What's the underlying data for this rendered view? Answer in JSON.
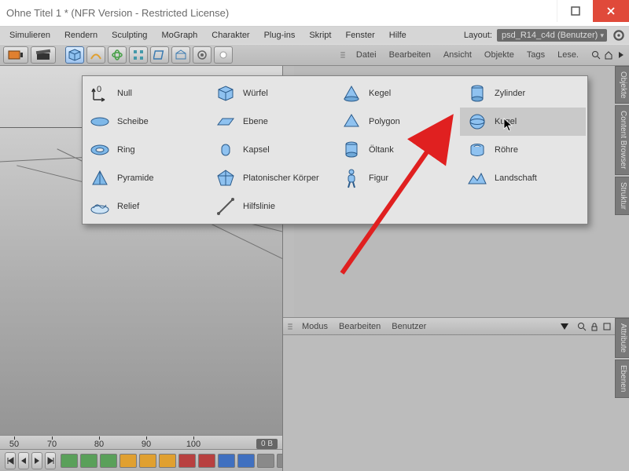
{
  "title": "Ohne Titel 1 * (NFR Version - Restricted License)",
  "menu": [
    "Simulieren",
    "Rendern",
    "Sculpting",
    "MoGraph",
    "Charakter",
    "Plug-ins",
    "Skript",
    "Fenster",
    "Hilfe"
  ],
  "layout_label": "Layout:",
  "layout_value": "psd_R14_c4d (Benutzer)",
  "obj_toolbar": [
    "Datei",
    "Bearbeiten",
    "Ansicht",
    "Objekte",
    "Tags",
    "Lese."
  ],
  "ruler": [
    "50",
    "70",
    "80",
    "90",
    "100"
  ],
  "size_label": "0 B",
  "attr_hdr": [
    "Modus",
    "Bearbeiten",
    "Benutzer"
  ],
  "side_tabs_top": [
    "Objekte",
    "Content Browser",
    "Struktur"
  ],
  "side_tabs_bottom": [
    "Attribute",
    "Ebenen"
  ],
  "primitives": {
    "col1": [
      "Null",
      "Scheibe",
      "Ring",
      "Pyramide",
      "Relief"
    ],
    "col2": [
      "Würfel",
      "Ebene",
      "Kapsel",
      "Platonischer Körper",
      "Hilfslinie"
    ],
    "col3": [
      "Kegel",
      "Polygon",
      "Öltank",
      "Figur"
    ],
    "col4": [
      "Zylinder",
      "Kugel",
      "Röhre",
      "Landschaft"
    ]
  },
  "hover_item": "Kugel",
  "icons": {
    "col1": [
      "null",
      "disc",
      "torus",
      "pyramid",
      "relief"
    ],
    "col2": [
      "cube",
      "plane",
      "capsule",
      "platonic",
      "guide"
    ],
    "col3": [
      "cone",
      "polygon",
      "oiltank",
      "figure"
    ],
    "col4": [
      "cylinder",
      "sphere",
      "tube",
      "landscape"
    ]
  },
  "chip_colors": [
    "#5aa05a",
    "#5aa05a",
    "#5aa05a",
    "#e0a030",
    "#e0a030",
    "#e0a030",
    "#b84040",
    "#b84040",
    "#4070c0",
    "#4070c0",
    "#8a8a8a",
    "#8a8a8a",
    "#60a060"
  ]
}
